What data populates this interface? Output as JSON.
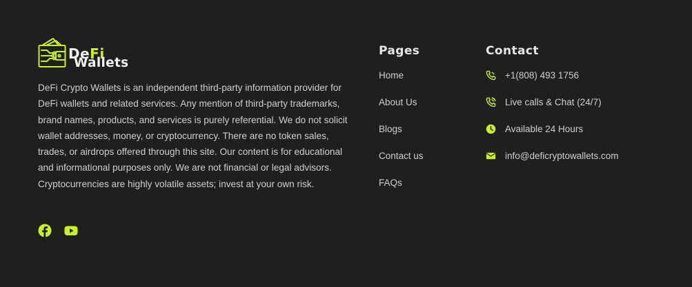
{
  "colors": {
    "background": "#1f1f1f",
    "accent": "#c8f31d",
    "text": "#cfcfcf",
    "heading": "#e6e6e6"
  },
  "brand": {
    "logo_word1_white": "De",
    "logo_word1_accent": "Fi",
    "logo_word2": "Wallets",
    "logo_icon": "wallet-circuit-icon",
    "description": "DeFi Crypto Wallets is an independent third-party information provider for DeFi wallets and related services. Any mention of third-party trademarks, brand names, products, and services is purely referential. We do not solicit wallet addresses, money, or cryptocurrency. There are no token sales, trades, or airdrops offered through this site. Our content is for educational and informational purposes only. We are not financial or legal advisors. Cryptocurrencies are highly volatile assets; invest at your own risk.",
    "social": [
      {
        "icon": "facebook-icon"
      },
      {
        "icon": "youtube-icon"
      }
    ]
  },
  "pages": {
    "title": "Pages",
    "items": [
      {
        "label": "Home"
      },
      {
        "label": "About Us"
      },
      {
        "label": "Blogs"
      },
      {
        "label": "Contact us"
      },
      {
        "label": "FAQs"
      }
    ]
  },
  "contact": {
    "title": "Contact",
    "items": [
      {
        "icon": "phone-icon",
        "text": "+1(808) 493 1756"
      },
      {
        "icon": "phone-calling-icon",
        "text": "Live calls & Chat (24/7)"
      },
      {
        "icon": "clock-icon",
        "text": "Available 24 Hours"
      },
      {
        "icon": "envelope-icon",
        "text": "info@deficryptowallets.com"
      }
    ]
  }
}
